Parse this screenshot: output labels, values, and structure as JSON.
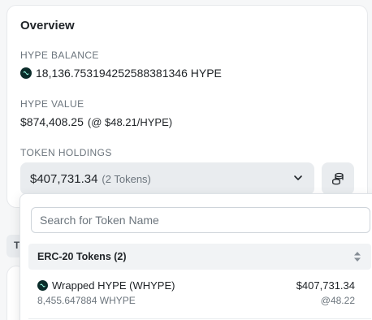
{
  "overview": {
    "title": "Overview",
    "balance_label": "HYPE BALANCE",
    "balance_value": "18,136.753194252588381346 HYPE",
    "value_label": "HYPE VALUE",
    "value_amount": "$874,408.25",
    "value_rate": "(@ $48.21/HYPE)",
    "holdings_label": "TOKEN HOLDINGS",
    "holdings_total": "$407,731.34",
    "holdings_count": "(2 Tokens)"
  },
  "behind": {
    "tab_letter": "T"
  },
  "dropdown": {
    "search_placeholder": "Search for Token Name",
    "group_title": "ERC-20 Tokens (2)",
    "tokens": [
      {
        "name": "Wrapped HYPE (WHYPE)",
        "quantity": "8,455.647884 WHYPE",
        "usd_value": "$407,731.34",
        "price": "@48.22",
        "icon": "hype-token-icon"
      }
    ]
  },
  "icons": {
    "hype": "hype-token-icon",
    "chevron": "chevron-down-icon",
    "coins": "coin-stack-icon",
    "sort": "sort-icon"
  },
  "colors": {
    "hype_green": "#0b2c2a",
    "hype_mint": "#97fce4",
    "muted": "#6c757d",
    "control_bg": "#e9ecef"
  }
}
